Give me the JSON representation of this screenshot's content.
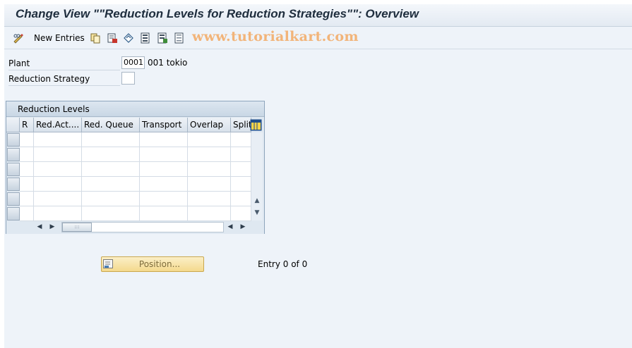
{
  "window": {
    "title": "Change View \"\"Reduction Levels for Reduction Strategies\"\": Overview"
  },
  "toolbar": {
    "items": [
      {
        "icon": "edit-glasses-icon"
      },
      {
        "label": "New Entries"
      },
      {
        "icon": "copy-icon"
      },
      {
        "icon": "delete-icon"
      },
      {
        "icon": "undo-change-icon"
      },
      {
        "icon": "select-all-icon"
      },
      {
        "icon": "select-block-icon"
      },
      {
        "icon": "deselect-all-icon"
      }
    ]
  },
  "watermark": "www.tutorialkart.com",
  "fields": {
    "plant": {
      "label": "Plant",
      "value": "0001",
      "description": "001 tokio"
    },
    "reduction_strategy": {
      "label": "Reduction Strategy",
      "value": ""
    }
  },
  "table": {
    "title": "Reduction Levels",
    "columns": [
      "R",
      "Red.Act....",
      "Red. Queue",
      "Transport",
      "Overlap",
      "Split"
    ],
    "row_count": 6
  },
  "footer": {
    "position_button": "Position...",
    "entry_text": "Entry 0 of 0"
  },
  "colors": {
    "background": "#eef3f9",
    "accent": "#f2b479"
  }
}
